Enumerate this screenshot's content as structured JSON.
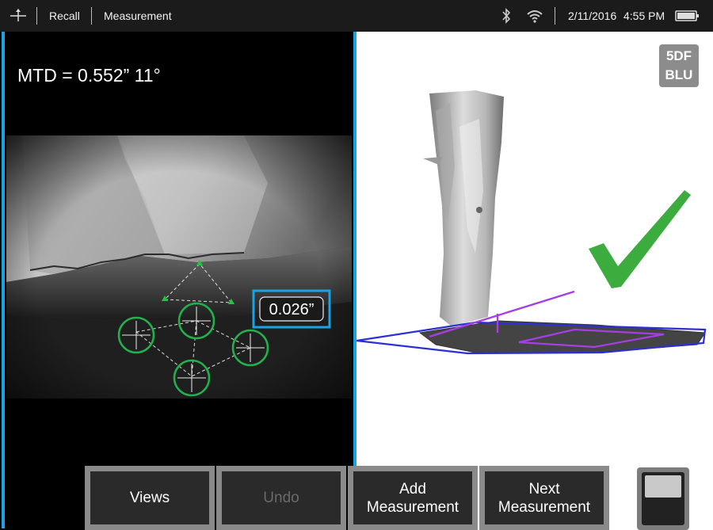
{
  "topbar": {
    "nav_icon": "crosshair-arrows-icon",
    "recall_label": "Recall",
    "title": "Measurement",
    "date": "2/11/2016",
    "time": "4:55 PM",
    "status_icons": [
      "bluetooth-icon",
      "wifi-icon",
      "battery-icon"
    ]
  },
  "left_view": {
    "mtd_readout": "MTD = 0.552” 11°",
    "depth_label": "0.026”"
  },
  "right_view": {
    "probe_badge_line1": "5DF",
    "probe_badge_line2": "BLU",
    "result_icon": "check-mark-icon"
  },
  "bottom_bar": {
    "views_label": "Views",
    "undo_label": "Undo",
    "add_measurement_line1": "Add",
    "add_measurement_line2": "Measurement",
    "next_measurement_line1": "Next",
    "next_measurement_line2": "Measurement"
  },
  "colors": {
    "accent_blue": "#1aa3e0",
    "cursor_green": "#22b14c",
    "check_green": "#3dac3f",
    "plane_blue": "#2d2fd6",
    "measure_purple": "#9b3fe0"
  }
}
